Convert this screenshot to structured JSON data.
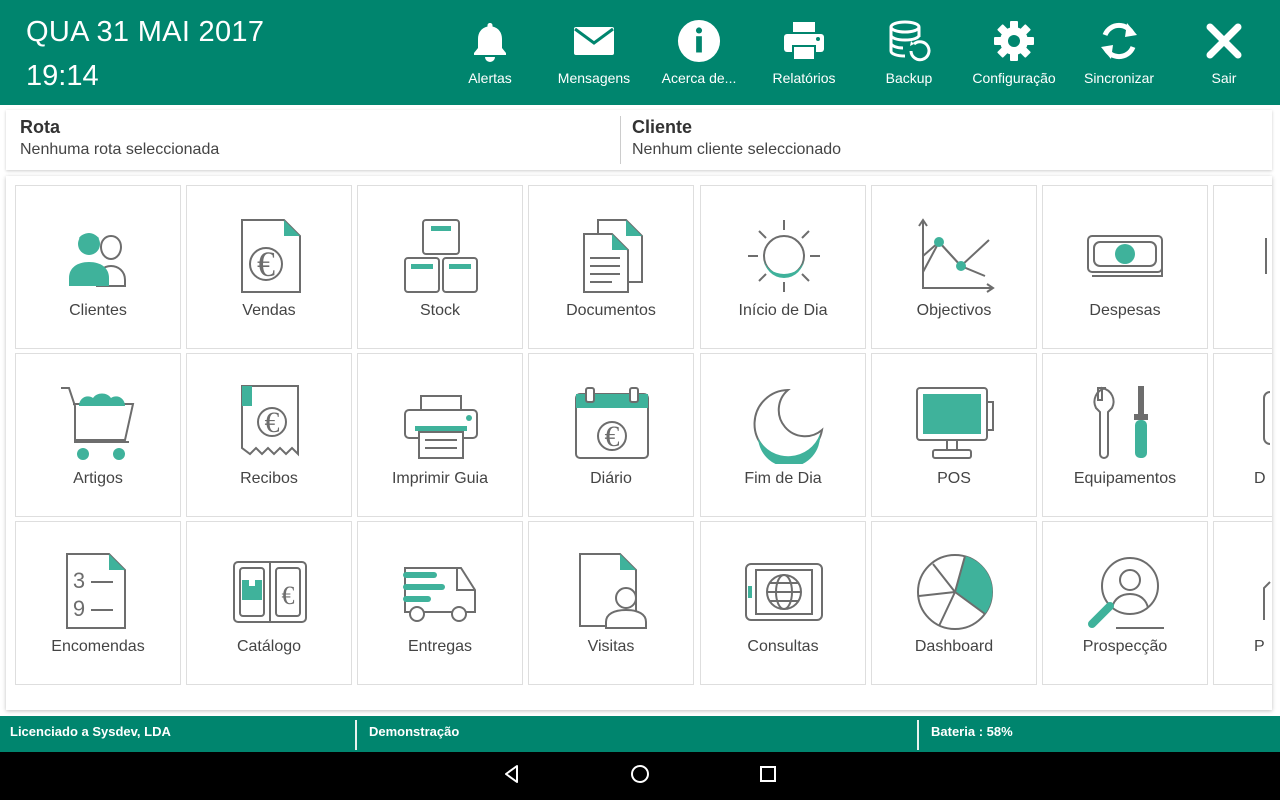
{
  "header": {
    "date": "QUA 31 MAI 2017",
    "time": "19:14",
    "actions": [
      {
        "label": "Alertas",
        "icon": "bell-icon"
      },
      {
        "label": "Mensagens",
        "icon": "envelope-icon"
      },
      {
        "label": "Acerca de...",
        "icon": "info-icon"
      },
      {
        "label": "Relatórios",
        "icon": "printer-icon"
      },
      {
        "label": "Backup",
        "icon": "database-restore-icon"
      },
      {
        "label": "Configuração",
        "icon": "gear-icon"
      },
      {
        "label": "Sincronizar",
        "icon": "sync-icon"
      },
      {
        "label": "Sair",
        "icon": "close-icon"
      }
    ]
  },
  "context": {
    "route_title": "Rota",
    "route_value": "Nenhuma rota seleccionada",
    "client_title": "Cliente",
    "client_value": "Nenhum cliente seleccionado"
  },
  "tiles": [
    {
      "label": "Clientes",
      "icon": "clients-icon"
    },
    {
      "label": "Vendas",
      "icon": "sales-document-icon"
    },
    {
      "label": "Stock",
      "icon": "stock-boxes-icon"
    },
    {
      "label": "Documentos",
      "icon": "documents-icon"
    },
    {
      "label": "Início de Dia",
      "icon": "sunrise-icon"
    },
    {
      "label": "Objectivos",
      "icon": "objectives-chart-icon"
    },
    {
      "label": "Despesas",
      "icon": "banknote-icon"
    },
    {
      "label": "Artigos",
      "icon": "shopping-cart-icon"
    },
    {
      "label": "Recibos",
      "icon": "receipt-icon"
    },
    {
      "label": "Imprimir Guia",
      "icon": "print-guide-icon"
    },
    {
      "label": "Diário",
      "icon": "calendar-euro-icon"
    },
    {
      "label": "Fim de Dia",
      "icon": "moon-icon"
    },
    {
      "label": "POS",
      "icon": "pos-monitor-icon"
    },
    {
      "label": "Equipamentos",
      "icon": "tools-icon"
    },
    {
      "label": "Encomendas",
      "icon": "order-list-icon"
    },
    {
      "label": "Catálogo",
      "icon": "catalog-icon"
    },
    {
      "label": "Entregas",
      "icon": "delivery-truck-icon"
    },
    {
      "label": "Visitas",
      "icon": "visit-icon"
    },
    {
      "label": "Consultas",
      "icon": "globe-tablet-icon"
    },
    {
      "label": "Dashboard",
      "icon": "pie-chart-icon"
    },
    {
      "label": "Prospecção",
      "icon": "prospect-search-icon"
    }
  ],
  "partial_tiles": [
    {
      "label": "",
      "icon": "partial-tile-icon"
    },
    {
      "label": "D",
      "icon": "partial-tile-icon"
    },
    {
      "label": "P",
      "icon": "partial-tile-icon"
    }
  ],
  "status": {
    "license": "Licenciado a Sysdev, LDA",
    "mode": "Demonstração",
    "battery": "Bateria : 58%"
  },
  "colors": {
    "primary": "#00856e",
    "accent": "#3fb29b",
    "icon_stroke": "#6d6d6d"
  }
}
